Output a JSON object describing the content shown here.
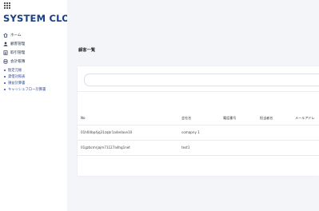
{
  "app": {
    "logo": "SYSTEM CLOUD",
    "menu_icon": "grid-icon"
  },
  "sidebar": {
    "items": [
      {
        "label": "ホーム",
        "icon": "home-icon"
      },
      {
        "label": "顧客管理",
        "icon": "user-icon"
      },
      {
        "label": "取引管理",
        "icon": "document-icon"
      },
      {
        "label": "会計帳簿",
        "icon": "database-icon"
      }
    ],
    "subitems": [
      {
        "label": "勘定元帳"
      },
      {
        "label": "貸借対照表"
      },
      {
        "label": "損益計算書"
      },
      {
        "label": "キャッシュフロー計算書"
      }
    ]
  },
  "main": {
    "title": "顧客一覧",
    "search": {
      "placeholder": ""
    },
    "table": {
      "headers": [
        "No",
        "会社名",
        "電話番号",
        "担当者名",
        "メールアドレ"
      ],
      "rows": [
        [
          "01h04bp4jq31zqbr1a4edave10",
          "comapny 1",
          "",
          "",
          ""
        ],
        [
          "01gzbcmrjajm71127a4hg1net",
          "test1",
          "",
          "",
          ""
        ]
      ]
    }
  },
  "colors": {
    "brand": "#1a3f85",
    "link": "#2b4aa0",
    "background": "#f4f5f8"
  }
}
